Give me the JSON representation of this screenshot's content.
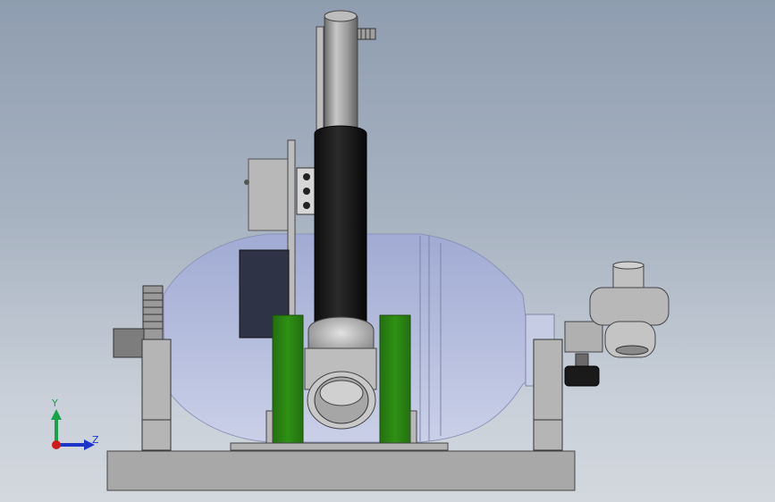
{
  "viewport": {
    "background_top": "#8f9db0",
    "background_bottom": "#d3d8de"
  },
  "triad": {
    "y_label": "Y",
    "z_label": "Z",
    "y_color": "#16a34a",
    "z_color": "#1d36c9",
    "x_color": "#d11b1b"
  },
  "model": {
    "support_color": "#2e8a12",
    "balloon_color": "#b8c2e6",
    "tube_color": "#1b1b1b",
    "metal_color": "#a9a9a9",
    "base_color": "#a5a5a5"
  }
}
